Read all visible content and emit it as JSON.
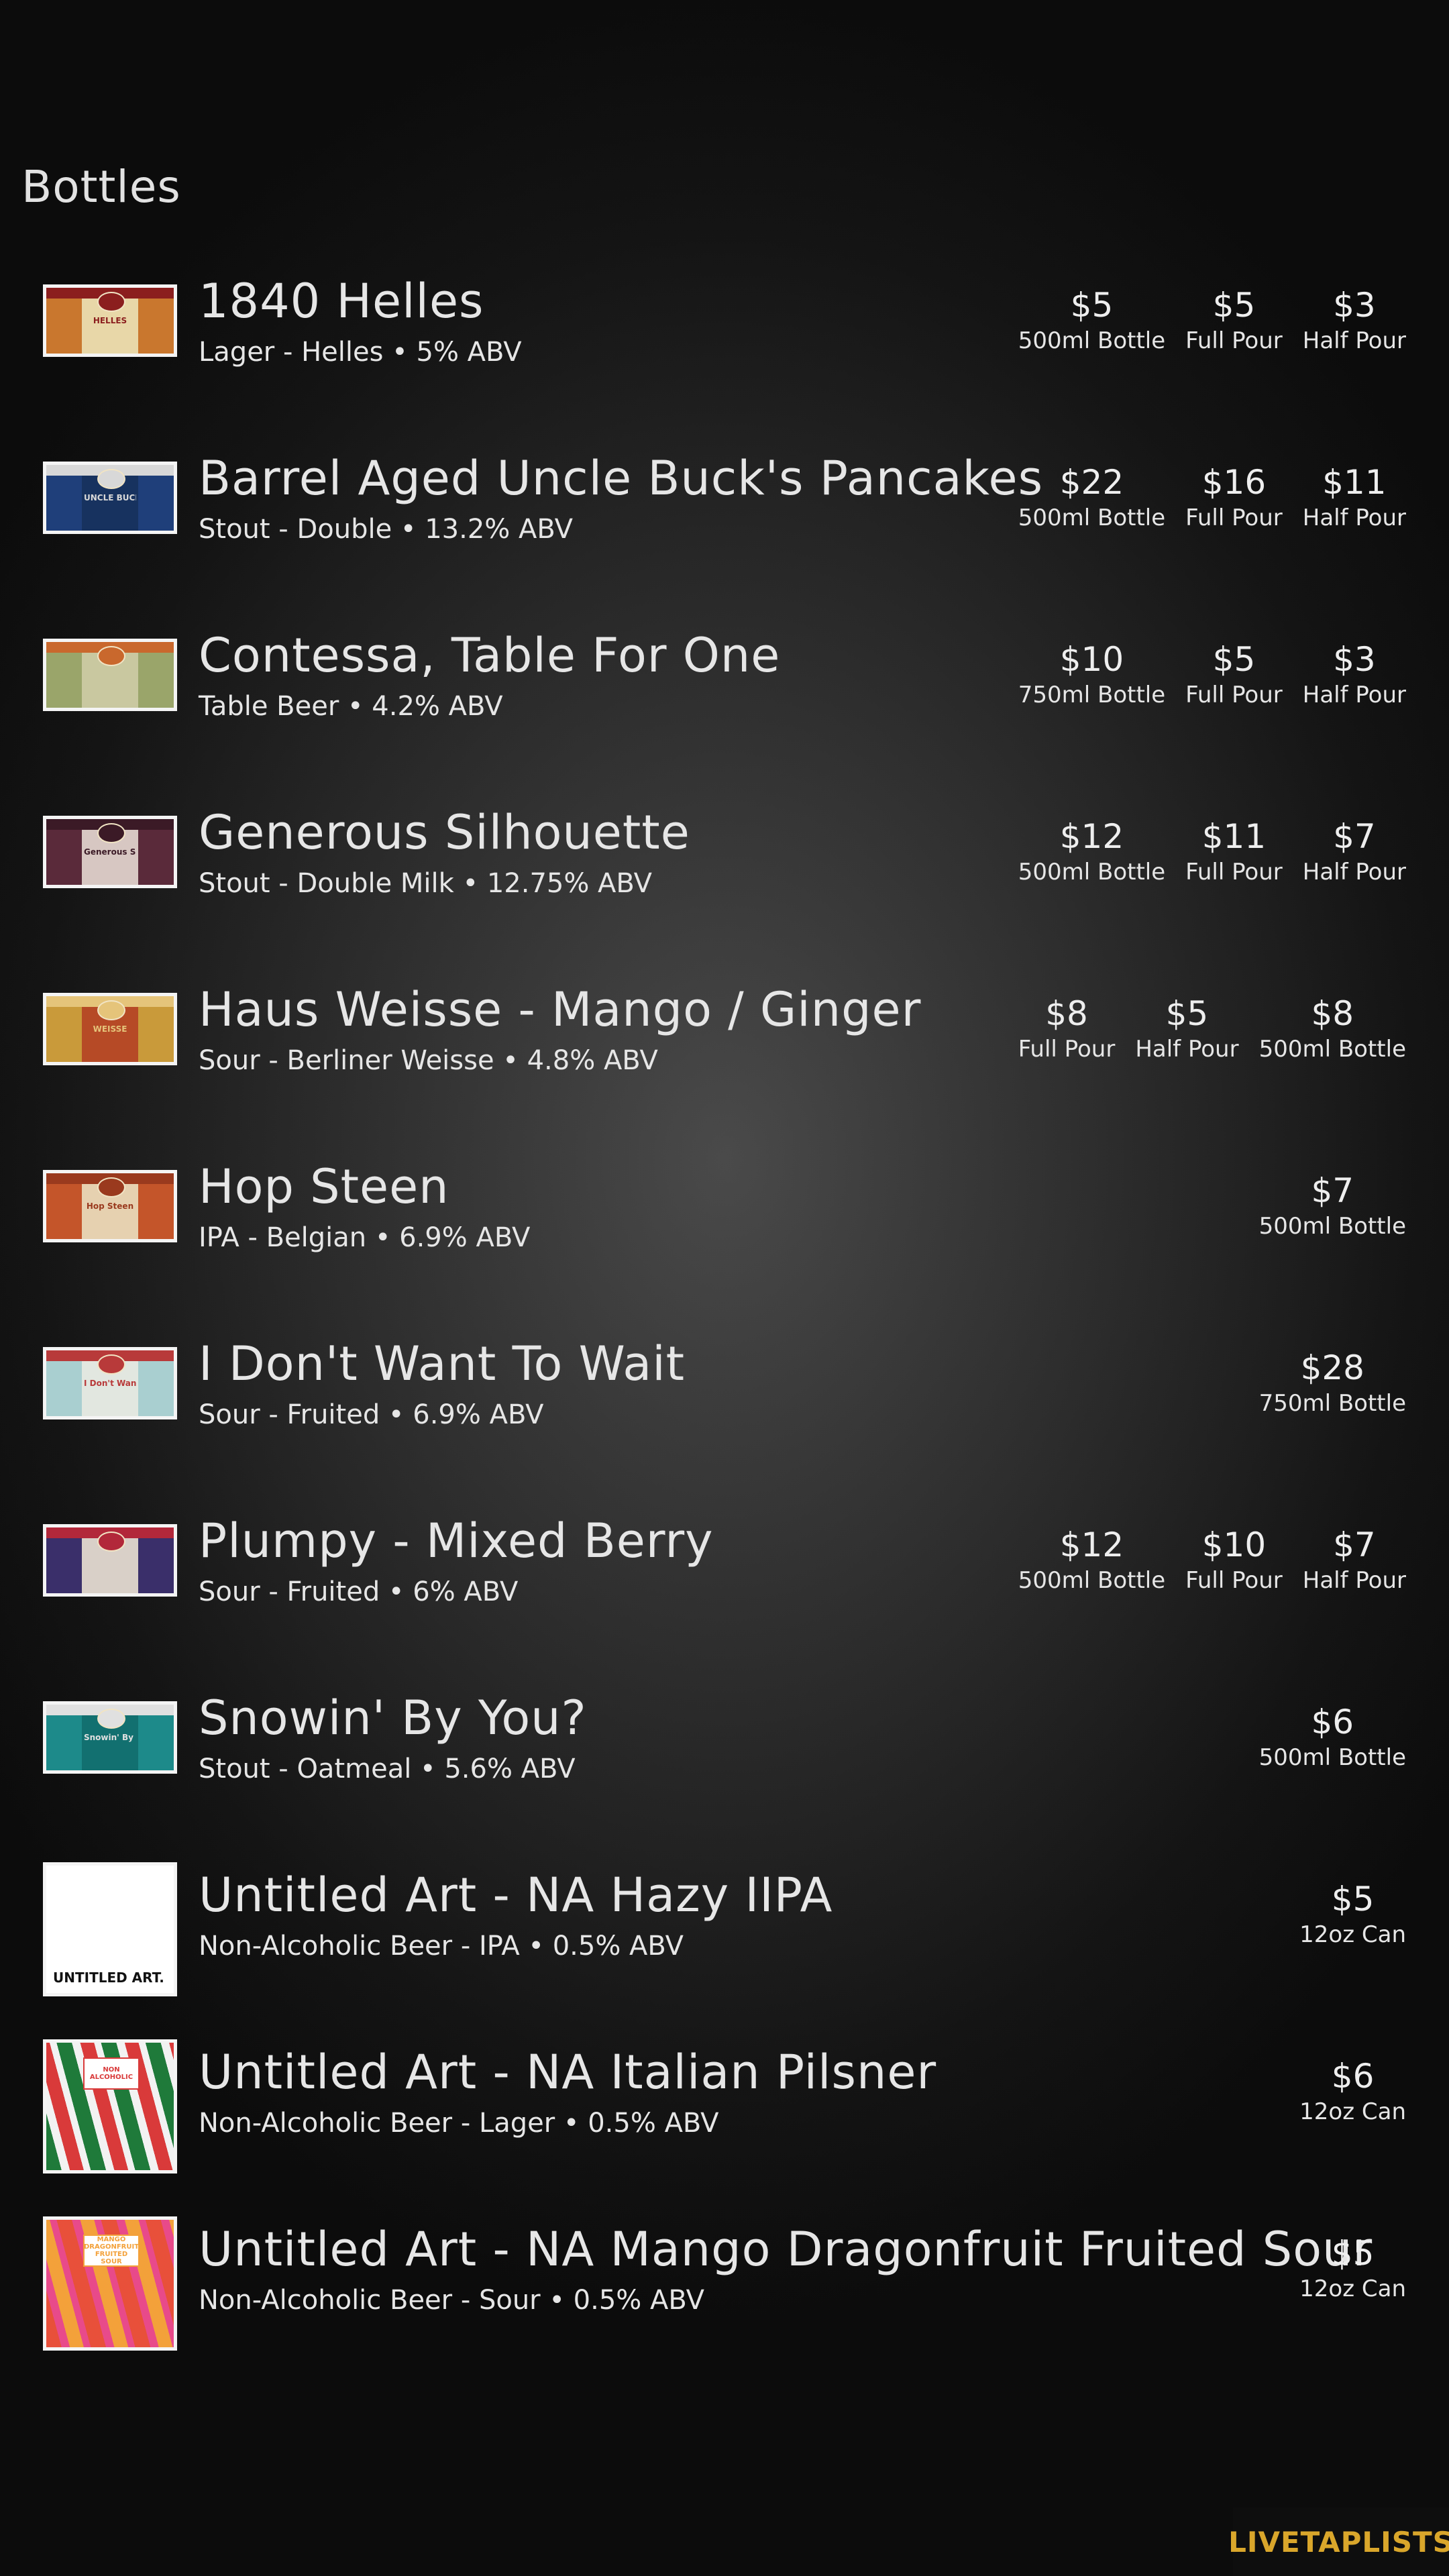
{
  "page": {
    "section_title": "Bottles"
  },
  "colors": {
    "background": "#1c1c1c",
    "text": "#e6e6e6",
    "brand": "#d9a62b"
  },
  "beers": [
    {
      "name": "1840 Helles",
      "style": "Lager - Helles • 5% ABV",
      "image": {
        "kind": "label",
        "colors": [
          "#c9772e",
          "#e8d7a8",
          "#8b1e1e"
        ],
        "text": "HELLES"
      },
      "prices": [
        {
          "amount": "$5",
          "size": "500ml Bottle"
        },
        {
          "amount": "$5",
          "size": "Full Pour"
        },
        {
          "amount": "$3",
          "size": "Half Pour"
        }
      ]
    },
    {
      "name": "Barrel Aged Uncle Buck's Pancakes",
      "style": "Stout - Double • 13.2% ABV",
      "image": {
        "kind": "label",
        "colors": [
          "#1f3f7a",
          "#17325f",
          "#d8d8d8"
        ],
        "text": "UNCLE BUCK'S"
      },
      "prices": [
        {
          "amount": "$22",
          "size": "500ml Bottle"
        },
        {
          "amount": "$16",
          "size": "Full Pour"
        },
        {
          "amount": "$11",
          "size": "Half Pour"
        }
      ]
    },
    {
      "name": "Contessa, Table For One",
      "style": "Table Beer • 4.2% ABV",
      "image": {
        "kind": "label",
        "colors": [
          "#9aa56a",
          "#c9c8a0",
          "#c9682d"
        ],
        "text": ""
      },
      "prices": [
        {
          "amount": "$10",
          "size": "750ml Bottle"
        },
        {
          "amount": "$5",
          "size": "Full Pour"
        },
        {
          "amount": "$3",
          "size": "Half Pour"
        }
      ]
    },
    {
      "name": "Generous Silhouette",
      "style": "Stout - Double Milk • 12.75% ABV",
      "image": {
        "kind": "label",
        "colors": [
          "#5a2a3a",
          "#d7c7c2",
          "#3b1a26"
        ],
        "text": "Generous Silhouette"
      },
      "prices": [
        {
          "amount": "$12",
          "size": "500ml Bottle"
        },
        {
          "amount": "$11",
          "size": "Full Pour"
        },
        {
          "amount": "$7",
          "size": "Half Pour"
        }
      ]
    },
    {
      "name": "Haus Weisse - Mango / Ginger",
      "style": "Sour - Berliner Weisse • 4.8% ABV",
      "image": {
        "kind": "label",
        "colors": [
          "#c99a3a",
          "#b64a26",
          "#e5c47a"
        ],
        "text": "WEISSE"
      },
      "prices": [
        {
          "amount": "$8",
          "size": "Full Pour"
        },
        {
          "amount": "$5",
          "size": "Half Pour"
        },
        {
          "amount": "$8",
          "size": "500ml Bottle"
        }
      ]
    },
    {
      "name": "Hop Steen",
      "style": "IPA - Belgian • 6.9% ABV",
      "image": {
        "kind": "label",
        "colors": [
          "#c4552a",
          "#e6d1b0",
          "#9a3a1e"
        ],
        "text": "Hop Steen"
      },
      "prices": [
        {
          "amount": "$7",
          "size": "500ml Bottle"
        }
      ]
    },
    {
      "name": "I Don't Want To Wait",
      "style": "Sour - Fruited • 6.9% ABV",
      "image": {
        "kind": "label",
        "colors": [
          "#a9cfd0",
          "#e2e7e0",
          "#b83a3a"
        ],
        "text": "I Don't Want To Wait"
      },
      "prices": [
        {
          "amount": "$28",
          "size": "750ml Bottle"
        }
      ]
    },
    {
      "name": "Plumpy - Mixed Berry",
      "style": "Sour - Fruited • 6% ABV",
      "image": {
        "kind": "label",
        "colors": [
          "#3a2f6a",
          "#d9d0c8",
          "#b2283a"
        ],
        "text": ""
      },
      "prices": [
        {
          "amount": "$12",
          "size": "500ml Bottle"
        },
        {
          "amount": "$10",
          "size": "Full Pour"
        },
        {
          "amount": "$7",
          "size": "Half Pour"
        }
      ]
    },
    {
      "name": "Snowin' By You?",
      "style": "Stout - Oatmeal • 5.6% ABV",
      "image": {
        "kind": "label",
        "colors": [
          "#1d8a8a",
          "#127070",
          "#e0e0e0"
        ],
        "text": "Snowin' By You?"
      },
      "prices": [
        {
          "amount": "$6",
          "size": "500ml Bottle"
        }
      ]
    },
    {
      "name": "Untitled Art - NA Hazy IIPA",
      "style": "Non-Alcoholic Beer - IPA • 0.5% ABV",
      "image": {
        "kind": "can",
        "colors": [
          "#ffffff",
          "#111111"
        ],
        "text": "UNTITLED ART."
      },
      "prices": [
        {
          "amount": "$5",
          "size": "12oz Can"
        }
      ]
    },
    {
      "name": "Untitled Art - NA Italian Pilsner",
      "style": "Non-Alcoholic Beer - Lager • 0.5% ABV",
      "image": {
        "kind": "can",
        "colors": [
          "#1f7a3a",
          "#d93a3a",
          "#f2f2f2"
        ],
        "text": "NON ALCOHOLIC"
      },
      "prices": [
        {
          "amount": "$6",
          "size": "12oz Can"
        }
      ]
    },
    {
      "name": "Untitled Art - NA Mango Dragonfruit Fruited Sour",
      "style": "Non-Alcoholic Beer - Sour • 0.5% ABV",
      "image": {
        "kind": "can",
        "colors": [
          "#e8503a",
          "#f3a13a",
          "#e84a8a"
        ],
        "text": "MANGO DRAGONFRUIT FRUITED SOUR"
      },
      "prices": [
        {
          "amount": "$5",
          "size": "12oz Can"
        }
      ]
    }
  ],
  "footer": {
    "brand": "LIVETAPLISTS"
  }
}
